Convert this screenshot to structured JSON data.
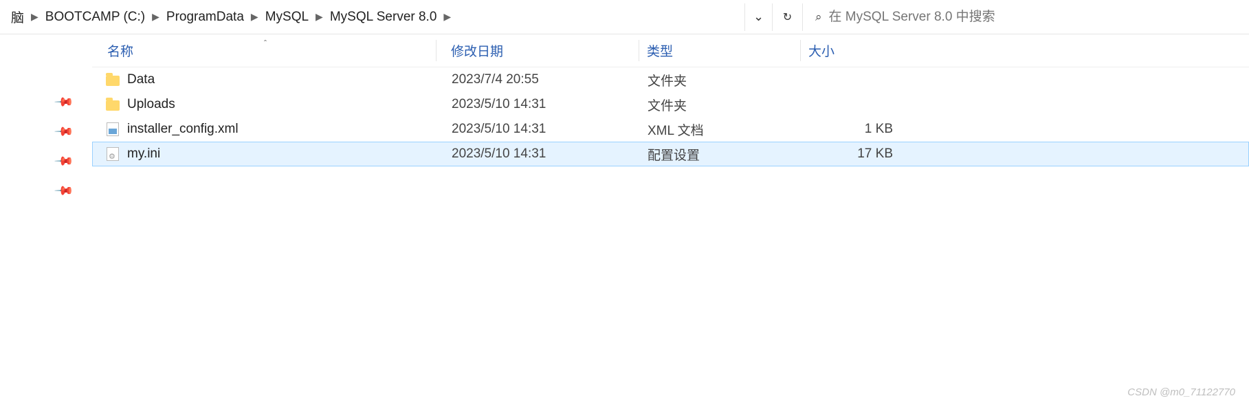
{
  "breadcrumb": {
    "first_fragment": "脑",
    "items": [
      "BOOTCAMP (C:)",
      "ProgramData",
      "MySQL",
      "MySQL Server 8.0"
    ]
  },
  "search": {
    "placeholder": "在 MySQL Server 8.0 中搜索"
  },
  "columns": {
    "name": "名称",
    "date": "修改日期",
    "type": "类型",
    "size": "大小"
  },
  "rows": [
    {
      "icon": "folder",
      "name": "Data",
      "date": "2023/7/4 20:55",
      "type": "文件夹",
      "size": "",
      "selected": false
    },
    {
      "icon": "folder",
      "name": "Uploads",
      "date": "2023/5/10 14:31",
      "type": "文件夹",
      "size": "",
      "selected": false
    },
    {
      "icon": "xml",
      "name": "installer_config.xml",
      "date": "2023/5/10 14:31",
      "type": "XML 文档",
      "size": "1 KB",
      "selected": false
    },
    {
      "icon": "ini",
      "name": "my.ini",
      "date": "2023/5/10 14:31",
      "type": "配置设置",
      "size": "17 KB",
      "selected": true
    }
  ],
  "watermark": "CSDN @m0_71122770"
}
